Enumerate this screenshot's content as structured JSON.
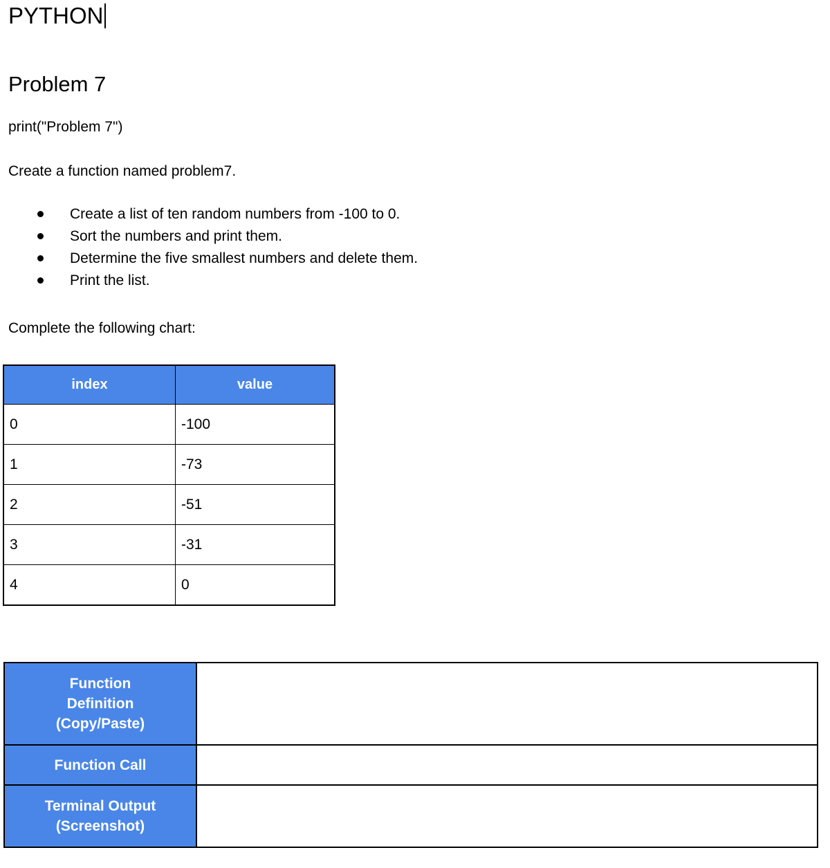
{
  "document": {
    "title": "PYTHON",
    "caret_visible": true,
    "problem_heading": "Problem 7",
    "print_statement": "print(\"Problem 7\")",
    "instruction": "Create a function named problem7.",
    "tasks": [
      "Create a list of ten random numbers from -100 to 0.",
      "Sort the numbers and print them.",
      "Determine the five smallest numbers and delete them.",
      "Print the list."
    ],
    "chart_prompt": "Complete the following chart:"
  },
  "chart_data": {
    "type": "table",
    "title": "Complete the following chart:",
    "columns": [
      "index",
      "value"
    ],
    "rows": [
      {
        "index": "0",
        "value": "-100"
      },
      {
        "index": "1",
        "value": "-73"
      },
      {
        "index": "2",
        "value": "-51"
      },
      {
        "index": "3",
        "value": "-31"
      },
      {
        "index": "4",
        "value": "0"
      }
    ],
    "categories": [
      "0",
      "1",
      "2",
      "3",
      "4"
    ],
    "values": [
      -100,
      -73,
      -51,
      -31,
      0
    ],
    "xlabel": "index",
    "ylabel": "value"
  },
  "deliverables": {
    "rows": [
      {
        "label": "Function Definition (Copy/Paste)",
        "label_lines": [
          "Function",
          "Definition",
          "(Copy/Paste)"
        ],
        "answer": ""
      },
      {
        "label": "Function Call",
        "label_lines": [
          "Function Call"
        ],
        "answer": ""
      },
      {
        "label": "Terminal Output (Screenshot)",
        "label_lines": [
          "Terminal Output",
          "(Screenshot)"
        ],
        "answer": ""
      }
    ]
  },
  "colors": {
    "header_blue": "#4a86e8",
    "header_text": "#ffffff",
    "border": "#000000",
    "body_text": "#000000",
    "page_background": "#ffffff"
  }
}
